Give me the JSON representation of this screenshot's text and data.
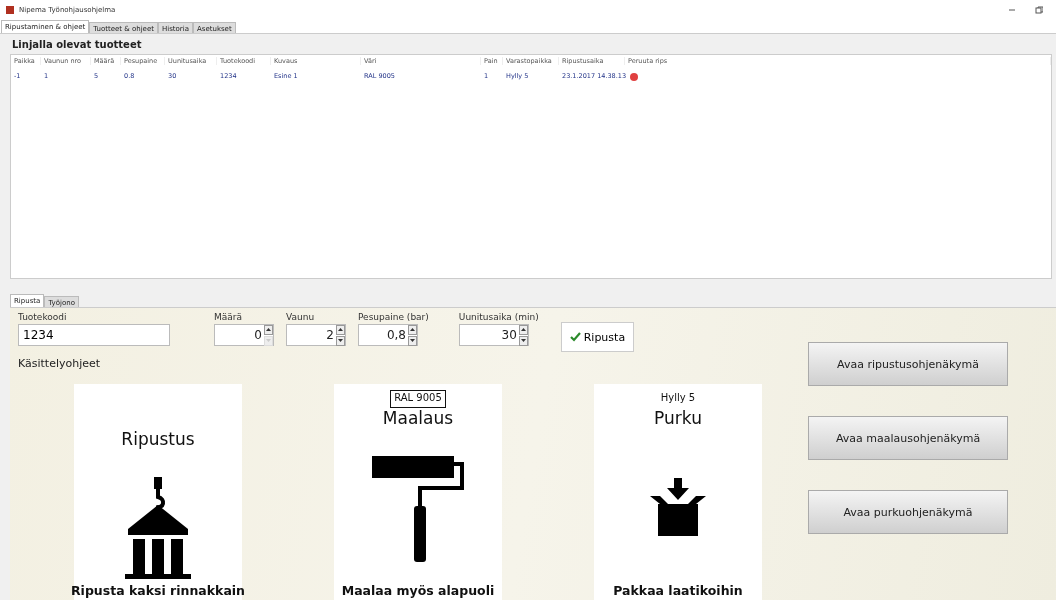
{
  "window": {
    "title": "Nipema Työnohjausohjelma"
  },
  "tabs": [
    {
      "label": "Ripustaminen & ohjeet",
      "selected": true
    },
    {
      "label": "Tuotteet & ohjeet",
      "selected": false
    },
    {
      "label": "Historia",
      "selected": false
    },
    {
      "label": "Asetukset",
      "selected": false
    }
  ],
  "line_products": {
    "title": "Linjalla olevat tuotteet",
    "columns": [
      "Paikka",
      "Vaunun nro",
      "Määrä",
      "Pesupaine",
      "Uunitusaika",
      "Tuotekoodi",
      "Kuvaus",
      "Väri",
      "Pain",
      "Varastopaikka",
      "Ripustusaika",
      "Peruuta rips"
    ],
    "rows": [
      {
        "cells": [
          "-1",
          "1",
          "5",
          "0.8",
          "30",
          "1234",
          "Esine 1",
          "RAL 9005",
          "1",
          "Hylly 5",
          "23.1.2017 14.38.13"
        ],
        "cancel": true
      }
    ]
  },
  "sub_tabs": [
    {
      "label": "Ripusta",
      "selected": true
    },
    {
      "label": "Työjono",
      "selected": false
    }
  ],
  "form": {
    "product_code": {
      "label": "Tuotekoodi",
      "value": "1234"
    },
    "spinners": [
      {
        "label": "Määrä",
        "value": "0",
        "down_disabled": true
      },
      {
        "label": "Vaunu",
        "value": "2",
        "down_disabled": false
      },
      {
        "label": "Pesupaine (bar)",
        "value": "0,8",
        "down_disabled": false
      },
      {
        "label": "Uunitusaika (min)",
        "value": "30",
        "down_disabled": false
      }
    ],
    "hang_button": "Ripusta",
    "instructions_label": "Käsittelyohjeet"
  },
  "cards": [
    {
      "kind": "hanging",
      "title": "Ripustus",
      "caption": "Ripusta kaksi rinnakkain"
    },
    {
      "kind": "painting",
      "tag": {
        "text": "RAL 9005",
        "boxed": true
      },
      "title": "Maalaus",
      "caption": "Maalaa myös alapuoli"
    },
    {
      "kind": "unpacking",
      "tag": {
        "text": "Hylly 5",
        "boxed": false
      },
      "title": "Purku",
      "caption": "Pakkaa laatikoihin"
    }
  ],
  "view_buttons": [
    "Avaa ripustusohjenäkymä",
    "Avaa maalausohjenäkymä",
    "Avaa purkuohjenäkymä"
  ]
}
